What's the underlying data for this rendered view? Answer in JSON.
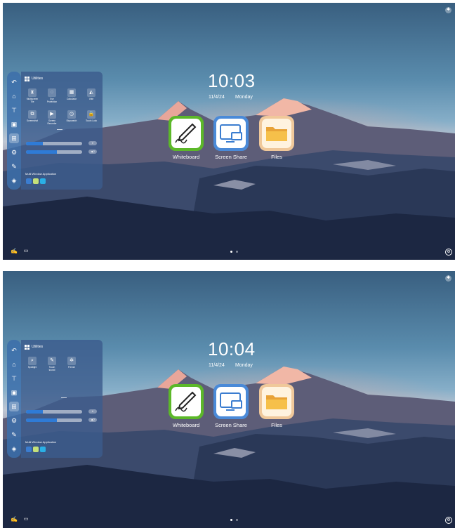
{
  "screens": [
    {
      "clock": "10:03",
      "date": "11/4/24",
      "day": "Monday",
      "tools": [
        {
          "label": "Multiscreen\nTile",
          "icon": "⧗"
        },
        {
          "label": "Eye\nProtection",
          "icon": "◌"
        },
        {
          "label": "Calculator",
          "icon": "▦"
        },
        {
          "label": "Vote",
          "icon": "◭"
        },
        {
          "label": "Screenshot",
          "icon": "⧉"
        },
        {
          "label": "Screen\nRecorder",
          "icon": "▶"
        },
        {
          "label": "Stopwatch",
          "icon": "◷"
        },
        {
          "label": "Touch Lock",
          "icon": "🔒"
        }
      ],
      "brightness_level": 0.3,
      "volume_level": 0.55,
      "volume_badge": "◀ 2"
    },
    {
      "clock": "10:04",
      "date": "11/4/24",
      "day": "Monday",
      "tools": [
        {
          "label": "Spotlight",
          "icon": "⌕"
        },
        {
          "label": "Touch\nsound",
          "icon": "✎"
        },
        {
          "label": "Freeze",
          "icon": "✲"
        }
      ],
      "brightness_level": 0.3,
      "volume_level": 0.55,
      "volume_badge": "◀ 2"
    }
  ],
  "apps": [
    {
      "label": "Whiteboard",
      "icon": "pen-icon"
    },
    {
      "label": "Screen Share",
      "icon": "screen-share-icon"
    },
    {
      "label": "Files",
      "icon": "folder-icon"
    }
  ],
  "panel": {
    "title": "Utilities",
    "multi_window_label": "Multi Window Application"
  },
  "sidebar_icons": [
    "back-icon",
    "home-icon",
    "signage-icon",
    "source-icon",
    "apps-grid-icon",
    "settings-icon",
    "annotate-icon",
    "layers-icon"
  ],
  "colors": {
    "whiteboard_green": "#5cb829",
    "screen_share_blue": "#4a8ad8",
    "files_orange": "#f0c89a",
    "slider_fill": "#2f7bd6"
  }
}
